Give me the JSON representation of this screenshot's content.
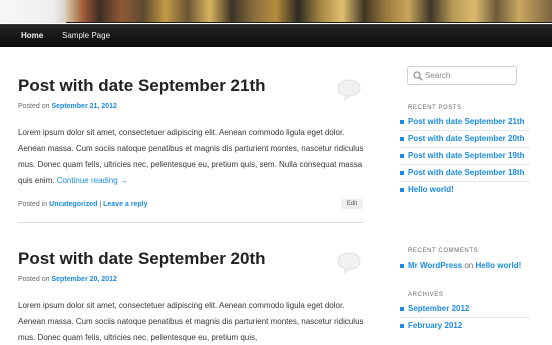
{
  "nav": {
    "items": [
      {
        "label": "Home",
        "active": true
      },
      {
        "label": "Sample Page",
        "active": false
      }
    ]
  },
  "posts": [
    {
      "title": "Post with date September 21th",
      "posted_on_prefix": "Posted on",
      "date": "September 21, 2012",
      "body": "Lorem ipsum dolor sit amet, consectetuer adipiscing elit. Aenean commodo ligula eget dolor. Aenean massa. Cum sociis natoque penatibus et magnis dis parturient montes, nascetur ridiculus mus. Donec quam felis, ultricies nec, pellentesque eu, pretium quis, sem. Nulla consequat massa quis enim.",
      "continue_label": "Continue reading →",
      "posted_in_prefix": "Posted in",
      "category": "Uncategorized",
      "separator": "|",
      "leave_reply": "Leave a reply",
      "edit_label": "Edit"
    },
    {
      "title": "Post with date September 20th",
      "posted_on_prefix": "Posted on",
      "date": "September 20, 2012",
      "body": "Lorem ipsum dolor sit amet, consectetuer adipiscing elit. Aenean commodo ligula eget dolor. Aenean massa. Cum sociis natoque penatibus et magnis dis parturient montes, nascetur ridiculus mus. Donec quam felis, ultricies nec, pellentesque eu, pretium quis,"
    }
  ],
  "sidebar": {
    "search_placeholder": "Search",
    "recent_posts_title": "RECENT POSTS",
    "recent_posts": [
      "Post with date September 21th",
      "Post with date September 20th",
      "Post with date September 19th",
      "Post with date September 18th",
      "Hello world!"
    ],
    "recent_comments_title": "RECENT COMMENTS",
    "recent_comment": {
      "author": "Mr WordPress",
      "on": "on",
      "post": "Hello world!"
    },
    "archives_title": "ARCHIVES",
    "archives": [
      "September 2012",
      "February 2012"
    ]
  },
  "colors": {
    "link": "#1b8be0",
    "nav_bg": "#111111"
  }
}
